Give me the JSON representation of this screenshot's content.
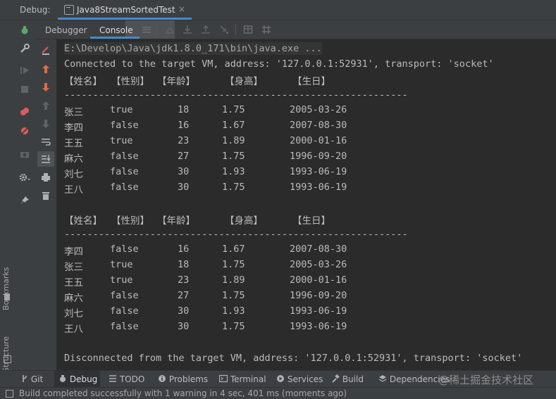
{
  "header": {
    "debug_label": "Debug:",
    "run_tab_label": "Java8StreamSortedTest",
    "close_glyph": "×"
  },
  "subtabs": {
    "debugger": "Debugger",
    "console": "Console"
  },
  "left_stripe": {
    "bookmarks": "Bookmarks",
    "structure": "Structure"
  },
  "console": {
    "path_line": "E:\\Develop\\Java\\jdk1.8.0_171\\bin\\java.exe ...",
    "connected_line": "Connected to the target VM, address: '127.0.0.1:52931', transport: 'socket'",
    "header_cols": [
      "【姓名】",
      "【性别】",
      "【年龄】",
      "【身高】",
      "【生日】"
    ],
    "separator": "------------------------------------------------------------",
    "table1": [
      [
        "张三",
        "true",
        "18",
        "1.75",
        "2005-03-26"
      ],
      [
        "李四",
        "false",
        "16",
        "1.67",
        "2007-08-30"
      ],
      [
        "王五",
        "true",
        "23",
        "1.89",
        "2000-01-16"
      ],
      [
        "麻六",
        "false",
        "27",
        "1.75",
        "1996-09-20"
      ],
      [
        "刘七",
        "false",
        "30",
        "1.93",
        "1993-06-19"
      ],
      [
        "王八",
        "false",
        "30",
        "1.75",
        "1993-06-19"
      ]
    ],
    "table2": [
      [
        "李四",
        "false",
        "16",
        "1.67",
        "2007-08-30"
      ],
      [
        "张三",
        "true",
        "18",
        "1.75",
        "2005-03-26"
      ],
      [
        "王五",
        "true",
        "23",
        "1.89",
        "2000-01-16"
      ],
      [
        "麻六",
        "false",
        "27",
        "1.75",
        "1996-09-20"
      ],
      [
        "刘七",
        "false",
        "30",
        "1.93",
        "1993-06-19"
      ],
      [
        "王八",
        "false",
        "30",
        "1.75",
        "1993-06-19"
      ]
    ],
    "disconnected_line": "Disconnected from the target VM, address: '127.0.0.1:52931', transport: 'socket'"
  },
  "bottom_tools": {
    "git": "Git",
    "debug": "Debug",
    "todo": "TODO",
    "problems": "Problems",
    "terminal": "Terminal",
    "services": "Services",
    "build": "Build",
    "dependencies": "Dependencies"
  },
  "status": {
    "text": "Build completed successfully with 1 warning in 4 sec, 401 ms (moments ago)"
  },
  "watermark": "@稀土掘金技术社区",
  "colors": {
    "background": "#2b2b2b",
    "panel": "#3c3f41",
    "accent": "#4a88c7",
    "text": "#bbbbbb"
  }
}
